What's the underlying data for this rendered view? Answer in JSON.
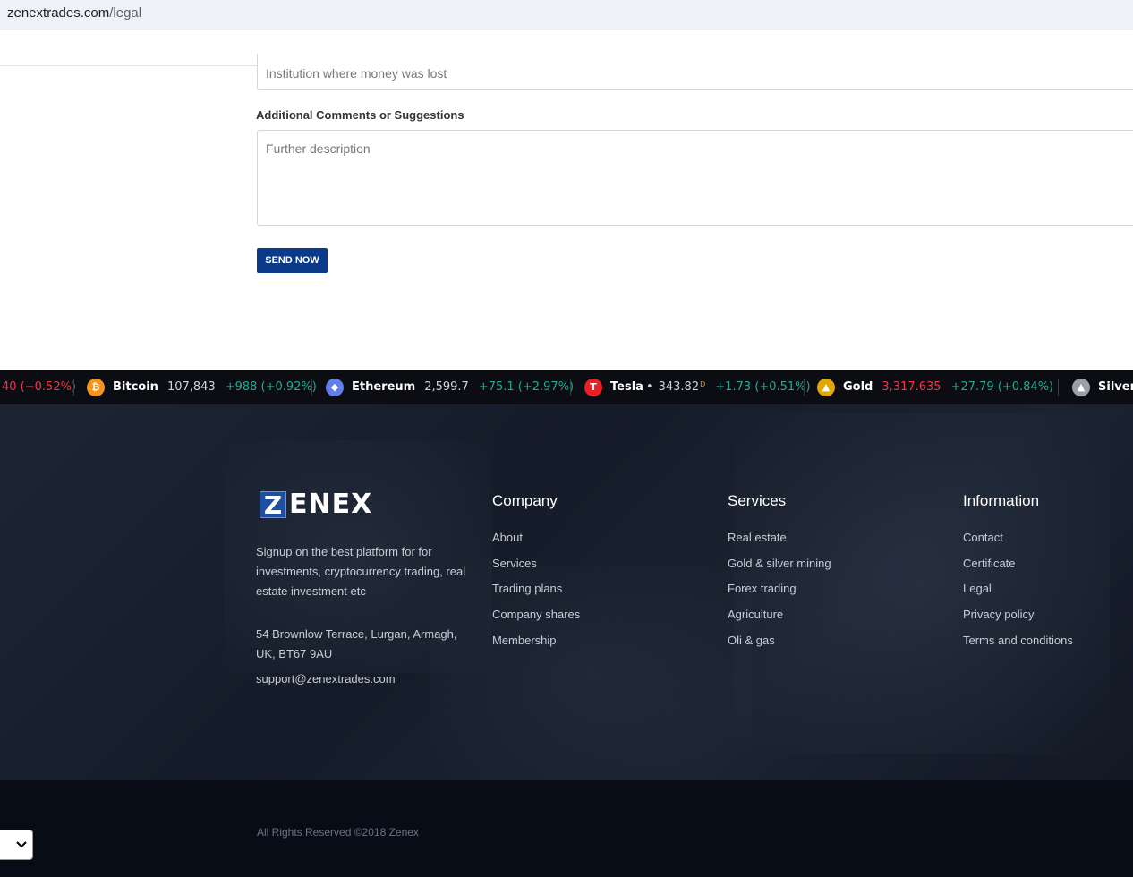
{
  "url": {
    "domain": "zenextrades.com",
    "path": "/legal"
  },
  "form": {
    "institution_placeholder": "Institution where money was lost",
    "comments_label": "Additional Comments or Suggestions",
    "comments_placeholder": "Further description",
    "send_label": "SEND NOW"
  },
  "ticker": {
    "lead_change": "40 (−0.52%)",
    "items": [
      {
        "name": "Bitcoin",
        "price": "107,843",
        "change": "+988 (+0.92%)",
        "icon": "bitcoin-icon",
        "color": "#f7931a",
        "glyph": "₿"
      },
      {
        "name": "Ethereum",
        "price": "2,599.7",
        "change": "+75.1 (+2.97%)",
        "icon": "ethereum-icon",
        "color": "#627eea",
        "glyph": "◆"
      },
      {
        "name": "Tesla",
        "price": "343.82",
        "price_flag": "D",
        "change": "+1.73 (+0.51%)",
        "icon": "tesla-icon",
        "color": "#e82127",
        "glyph": "T"
      },
      {
        "name": "Gold",
        "price": "3,317.635",
        "change": "+27.79 (+0.84%)",
        "icon": "gold-icon",
        "color": "#e0a800",
        "glyph": "▲"
      },
      {
        "name": "Silver",
        "icon": "silver-icon",
        "color": "#9aa0a6",
        "glyph": "▲"
      }
    ]
  },
  "footer": {
    "logo_mark": "Z",
    "logo_text": "ENEX",
    "about": "Signup on the best platform for for investments, cryptocurrency trading, real estate investment etc",
    "address": "54 Brownlow Terrace, Lurgan, Armagh, UK, BT67 9AU",
    "email": "support@zenextrades.com",
    "columns": [
      {
        "title": "Company",
        "links": [
          "About",
          "Services",
          "Trading plans",
          "Company shares",
          "Membership"
        ]
      },
      {
        "title": "Services",
        "links": [
          "Real estate",
          "Gold & silver mining",
          "Forex trading",
          "Agriculture",
          "Oli & gas"
        ]
      },
      {
        "title": "Information",
        "links": [
          "Contact",
          "Certificate",
          "Legal",
          "Privacy policy",
          "Terms and conditions"
        ]
      }
    ],
    "copyright": "All Rights Reserved ©2018 Zenex"
  },
  "language_select": {
    "value": "",
    "icon": "chevron-down-icon"
  }
}
